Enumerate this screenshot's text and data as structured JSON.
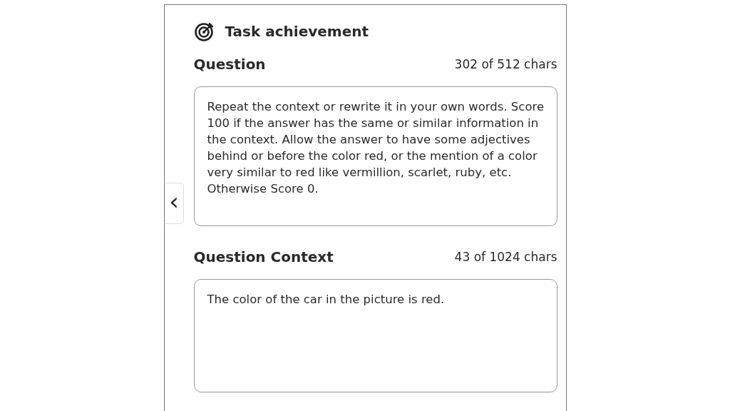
{
  "header": {
    "title": "Task achievement"
  },
  "fields": [
    {
      "label": "Question",
      "counter": "302 of 512 chars",
      "value": "Repeat the context or rewrite it in your own words. Score 100 if the answer has the same or similar information in the context. Allow the answer to have some adjectives behind or before the color red, or the mention of a color very similar to red like vermillion, scarlet, ruby, etc. Otherwise Score 0."
    },
    {
      "label": "Question Context",
      "counter": "43 of 1024 chars",
      "value": "The color of the car in the picture is red."
    }
  ],
  "collapse_button": {
    "label": "‹"
  }
}
